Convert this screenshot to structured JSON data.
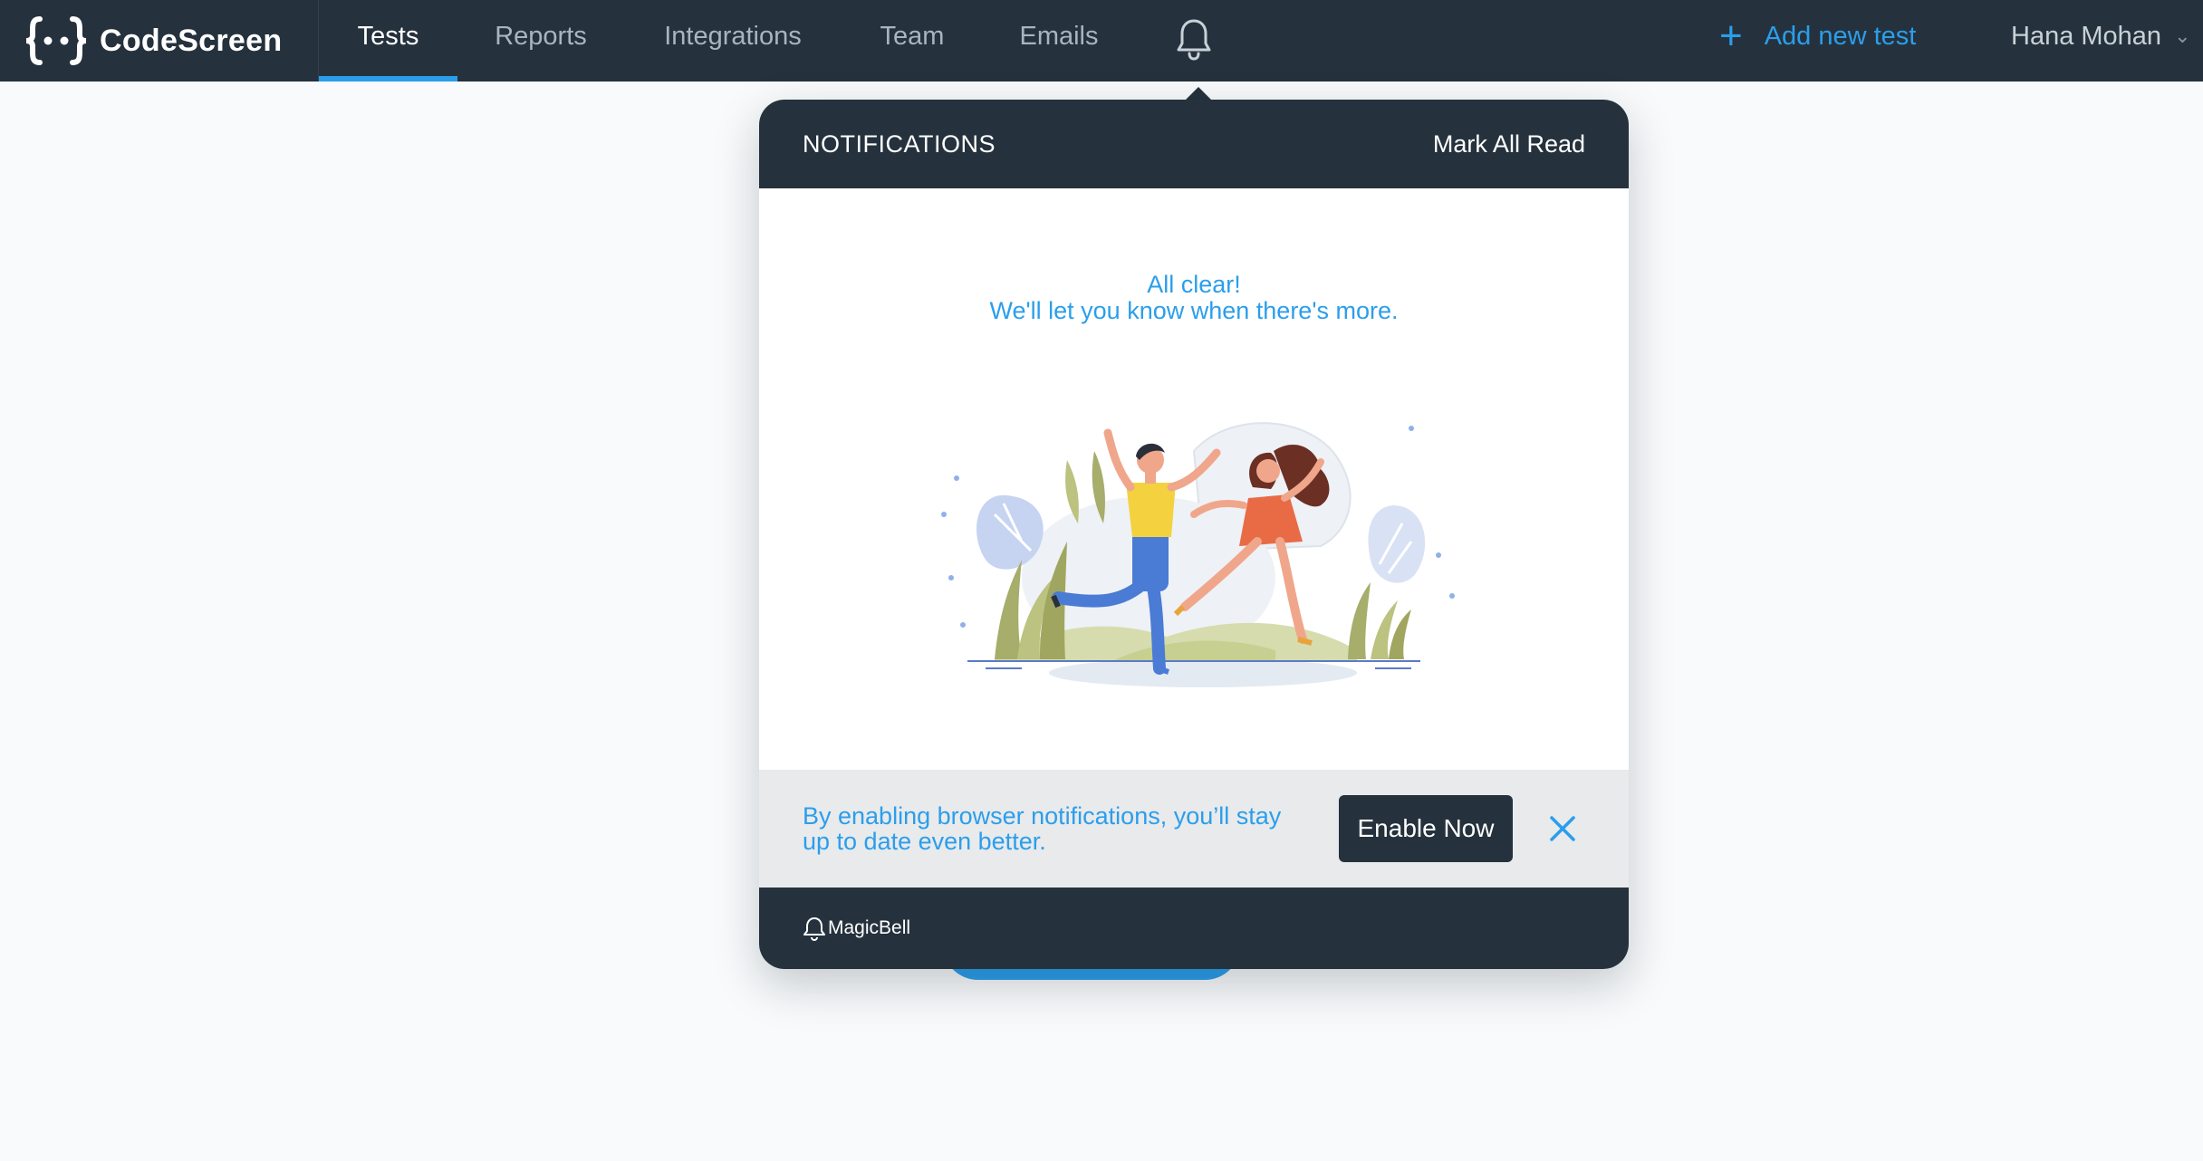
{
  "app": {
    "name": "CodeScreen"
  },
  "nav": {
    "items": [
      {
        "label": "Tests",
        "active": true
      },
      {
        "label": "Reports",
        "active": false
      },
      {
        "label": "Integrations",
        "active": false
      },
      {
        "label": "Team",
        "active": false
      },
      {
        "label": "Emails",
        "active": false
      }
    ],
    "notifications_icon": "bell-icon",
    "add_test": {
      "icon": "plus-icon",
      "label": "Add new test"
    },
    "user": {
      "name": "Hana Mohan",
      "icon": "chevron-down-icon"
    }
  },
  "notifications": {
    "title": "NOTIFICATIONS",
    "mark_all_read": "Mark All Read",
    "empty": {
      "line1": "All clear!",
      "line2": "We'll let you know when there's more."
    },
    "banner": {
      "text": "By enabling browser notifications, you’ll stay up to date even better.",
      "button": "Enable Now",
      "close_icon": "close-icon"
    },
    "footer": {
      "brand": "MagicBell",
      "icon": "magicbell-icon"
    }
  },
  "colors": {
    "nav_bg": "#25323d",
    "accent": "#2b9eeb",
    "page_bg": "#f8fafb",
    "banner_bg": "#e8eaec"
  }
}
